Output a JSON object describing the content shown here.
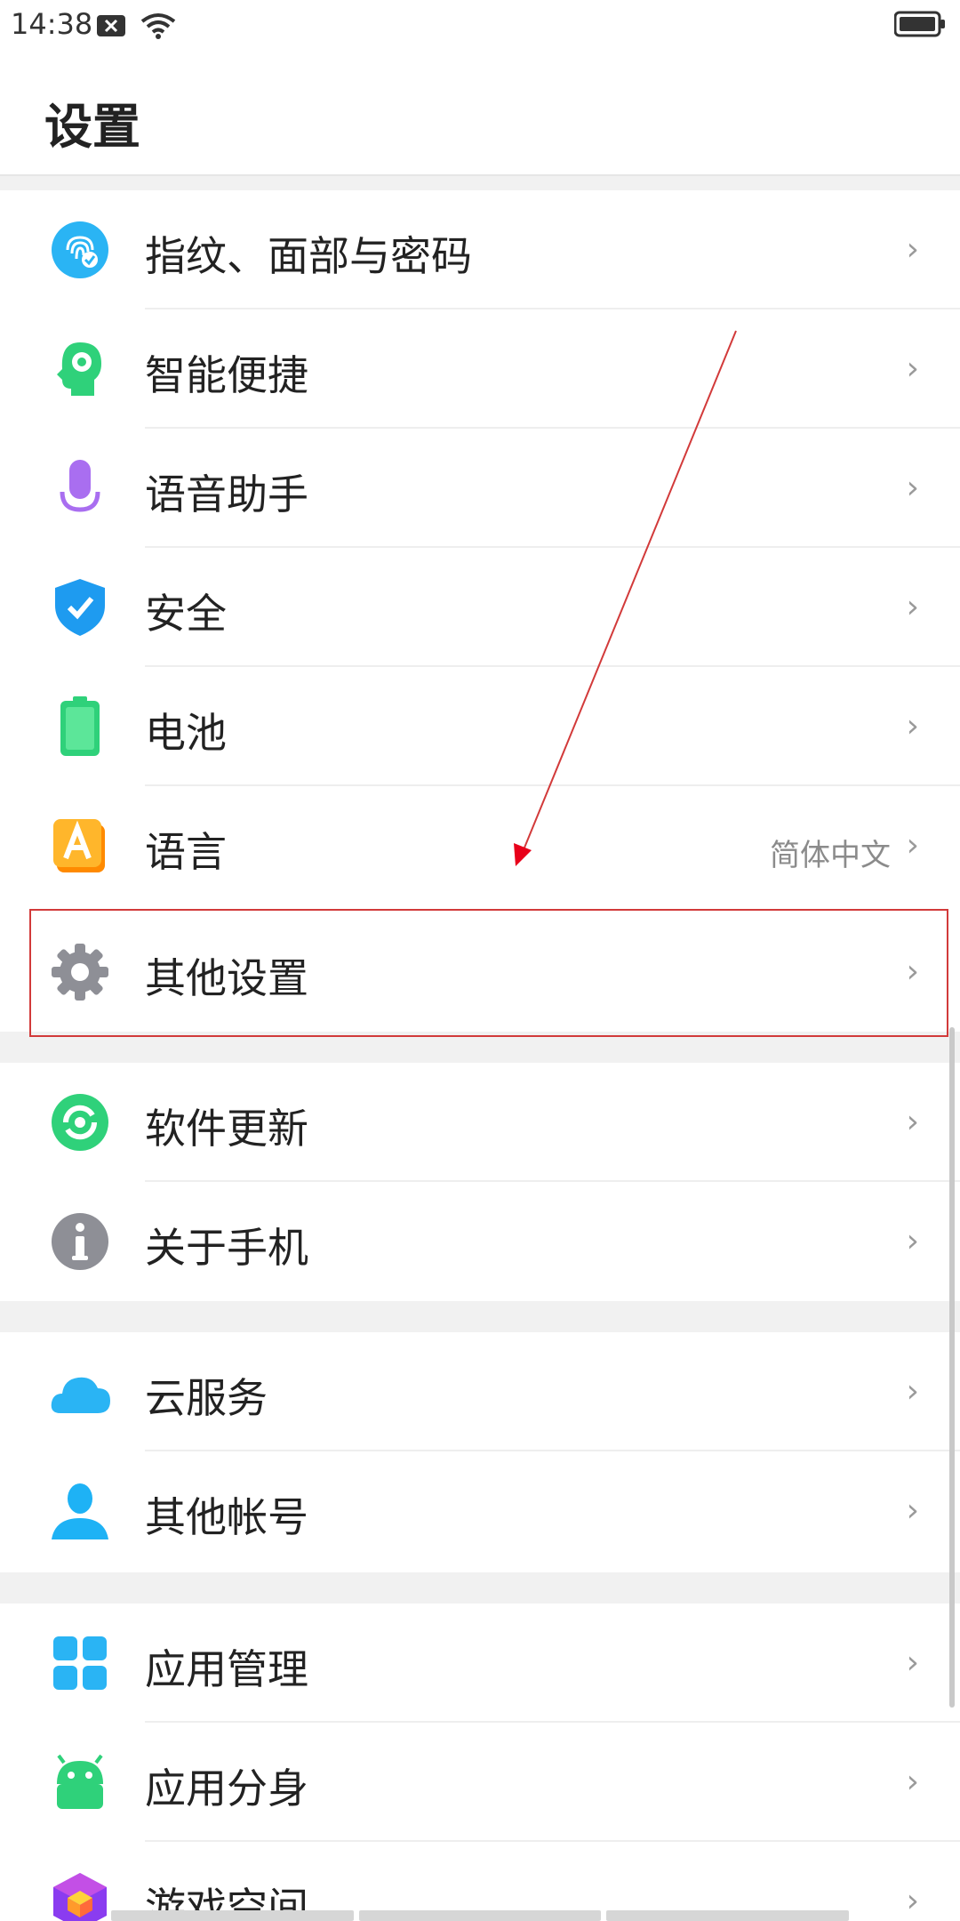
{
  "status_bar": {
    "time": "14:38",
    "icons": [
      "close-notification-icon",
      "wifi-icon",
      "battery-icon"
    ]
  },
  "page": {
    "title": "设置"
  },
  "items": [
    {
      "label": "指纹、面部与密码",
      "icon": "fingerprint-face-icon",
      "value": ""
    },
    {
      "label": "智能便捷",
      "icon": "smart-head-icon",
      "value": ""
    },
    {
      "label": "语音助手",
      "icon": "microphone-icon",
      "value": ""
    },
    {
      "label": "安全",
      "icon": "shield-check-icon",
      "value": ""
    },
    {
      "label": "电池",
      "icon": "battery-icon",
      "value": ""
    },
    {
      "label": "语言",
      "icon": "language-a-icon",
      "value": "简体中文"
    },
    {
      "label": "其他设置",
      "icon": "gear-icon",
      "value": ""
    },
    {
      "label": "软件更新",
      "icon": "update-icon",
      "value": ""
    },
    {
      "label": "关于手机",
      "icon": "info-icon",
      "value": ""
    },
    {
      "label": "云服务",
      "icon": "cloud-icon",
      "value": ""
    },
    {
      "label": "其他帐号",
      "icon": "user-icon",
      "value": ""
    },
    {
      "label": "应用管理",
      "icon": "app-grid-icon",
      "value": ""
    },
    {
      "label": "应用分身",
      "icon": "android-icon",
      "value": ""
    },
    {
      "label": "游戏空间",
      "icon": "game-cube-icon",
      "value": ""
    }
  ],
  "chevron": "›",
  "colors": {
    "accent_blue": "#2ab4f4",
    "green": "#2fd17a",
    "purple": "#a96ef0",
    "orange": "#ffae2b",
    "gray_icon": "#8e8f96",
    "highlight_red": "#d23a3a"
  }
}
